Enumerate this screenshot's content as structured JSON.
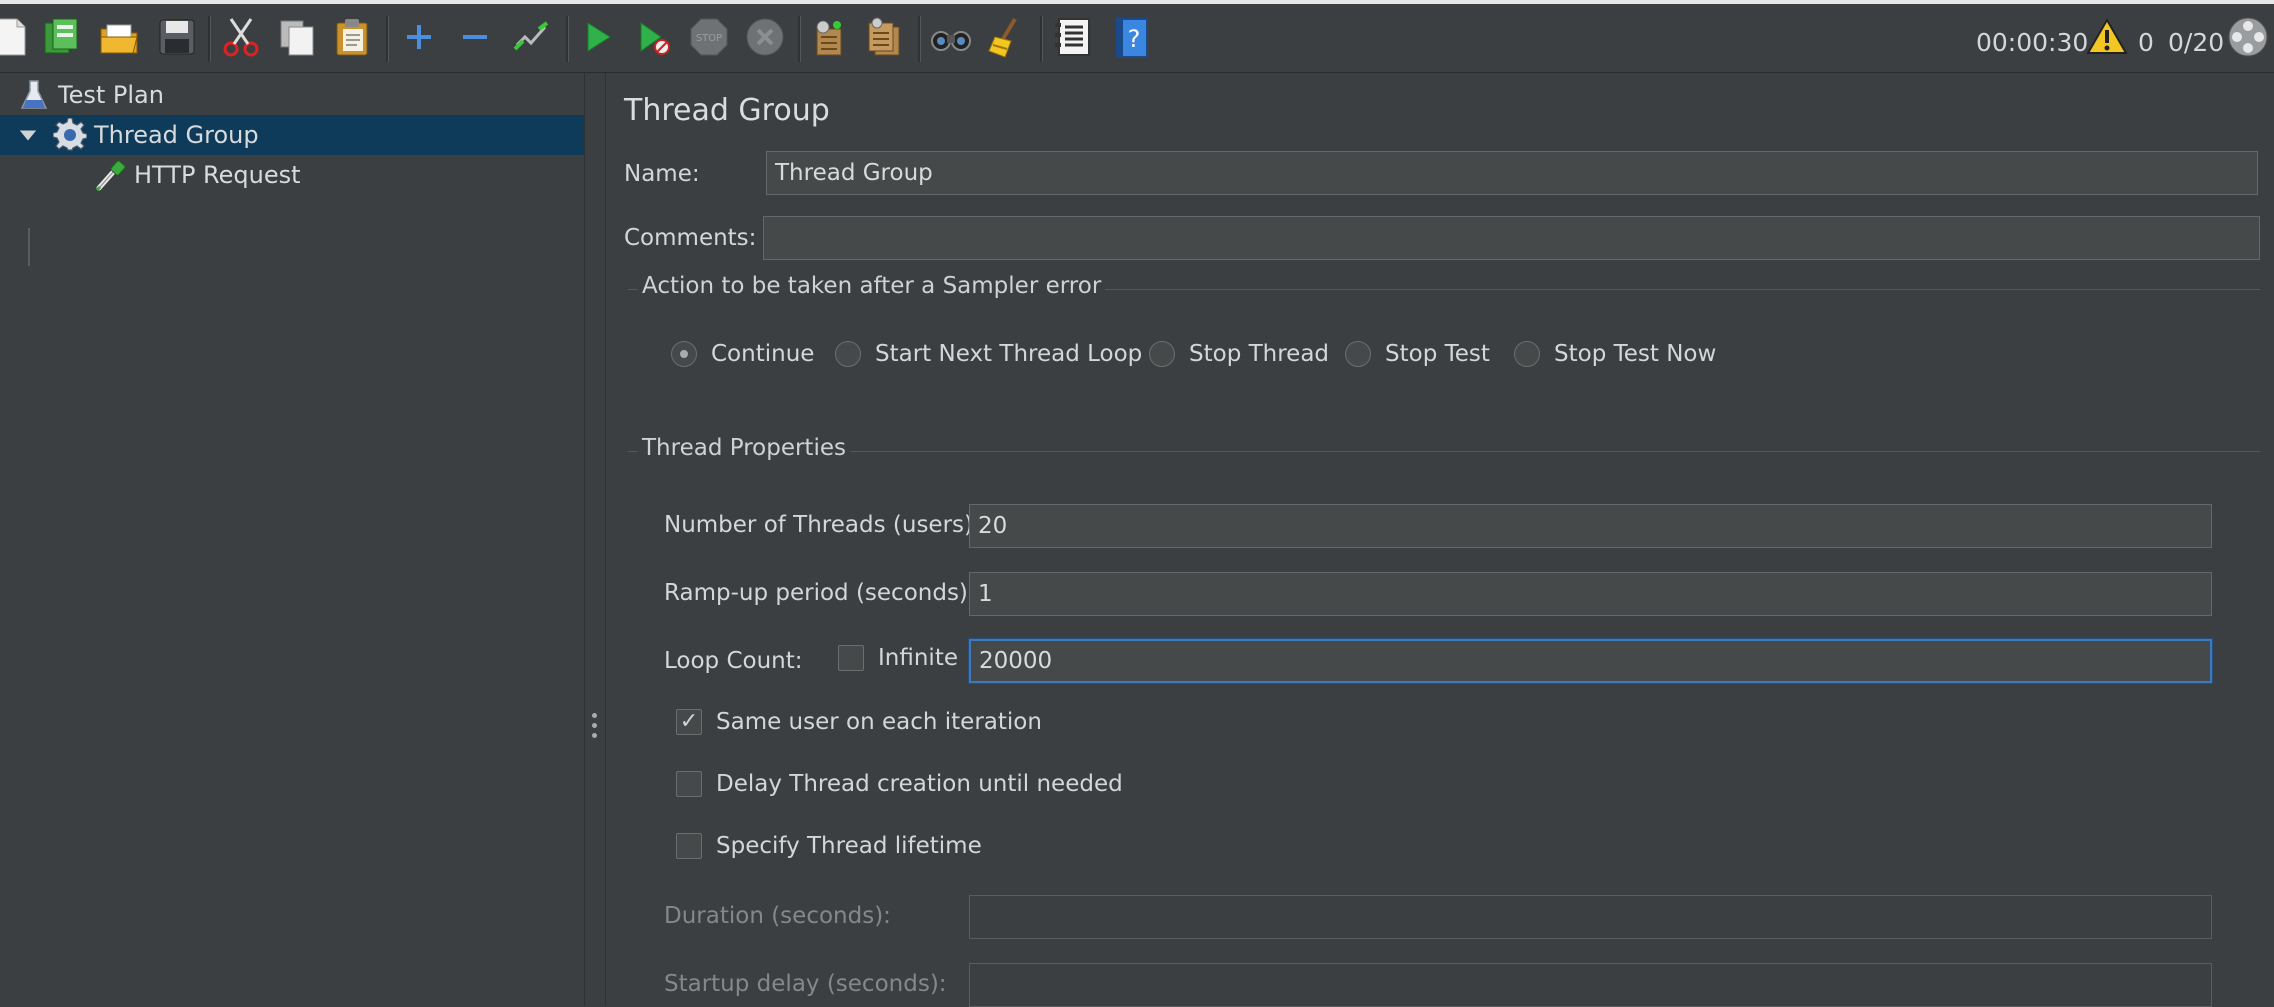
{
  "toolbar": {
    "buttons": [
      {
        "name": "new-icon"
      },
      {
        "name": "templates-icon"
      },
      {
        "name": "open-icon"
      },
      {
        "name": "save-icon"
      },
      {
        "name": "cut-icon"
      },
      {
        "name": "copy-icon"
      },
      {
        "name": "paste-icon"
      },
      {
        "name": "expand-icon"
      },
      {
        "name": "collapse-icon"
      },
      {
        "name": "toggle-icon"
      },
      {
        "name": "start-icon"
      },
      {
        "name": "start-no-pauses-icon"
      },
      {
        "name": "stop-icon"
      },
      {
        "name": "shutdown-icon"
      },
      {
        "name": "clear-icon"
      },
      {
        "name": "clear-all-icon"
      },
      {
        "name": "search-icon"
      },
      {
        "name": "reset-search-icon"
      },
      {
        "name": "function-helper-icon"
      },
      {
        "name": "help-icon"
      }
    ],
    "stop_label": "STOP",
    "help_label": "?",
    "elapsed_time": "00:00:30",
    "warning_count": "0",
    "active_threads": "0/20"
  },
  "tree": {
    "items": [
      {
        "label": "Test Plan",
        "icon": "test-plan-icon"
      },
      {
        "label": "Thread Group",
        "icon": "thread-group-gear-icon",
        "selected": true,
        "expanded": true
      },
      {
        "label": "HTTP Request",
        "icon": "http-request-pipette-icon"
      }
    ]
  },
  "form": {
    "title": "Thread Group",
    "name_label": "Name:",
    "name_value": "Thread Group",
    "comments_label": "Comments:",
    "comments_value": "",
    "sampler_error_section": "Action to be taken after a Sampler error",
    "sampler_error_options": [
      {
        "label": "Continue",
        "selected": true
      },
      {
        "label": "Start Next Thread Loop",
        "selected": false
      },
      {
        "label": "Stop Thread",
        "selected": false
      },
      {
        "label": "Stop Test",
        "selected": false
      },
      {
        "label": "Stop Test Now",
        "selected": false
      }
    ],
    "thread_properties_section": "Thread Properties",
    "threads_label": "Number of Threads (users):",
    "threads_value": "20",
    "rampup_label": "Ramp-up period (seconds):",
    "rampup_value": "1",
    "loop_label": "Loop Count:",
    "infinite_label": "Infinite",
    "infinite_checked": false,
    "loop_value": "20000",
    "same_user_label": "Same user on each iteration",
    "same_user_checked": true,
    "delay_label": "Delay Thread creation until needed",
    "delay_checked": false,
    "lifetime_label": "Specify Thread lifetime",
    "lifetime_checked": false,
    "duration_label": "Duration (seconds):",
    "duration_value": "",
    "startup_delay_label": "Startup delay (seconds):",
    "startup_delay_value": ""
  },
  "colors": {
    "background": "#3c3f41",
    "selection": "#0f3b5b",
    "focus_border": "#3f79bd",
    "start_green": "#2fb24a",
    "warning_yellow": "#f3c623"
  }
}
